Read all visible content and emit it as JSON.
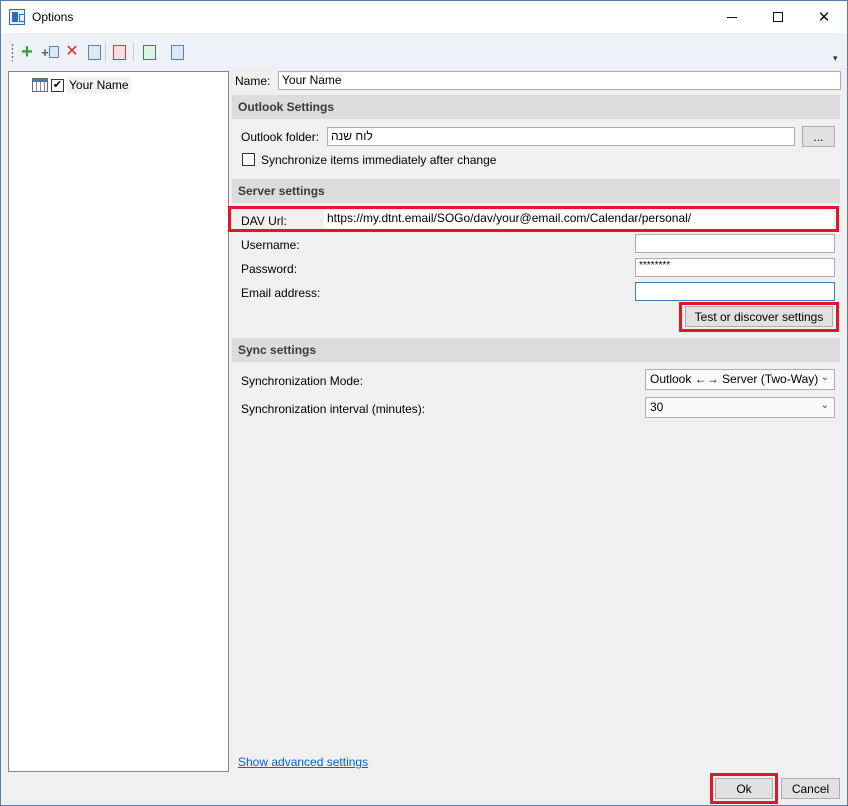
{
  "window": {
    "title": "Options",
    "min_glyph": "—",
    "max_glyph": "☐",
    "close_glyph": "✕"
  },
  "toolbar": {
    "icons": [
      "add-profile-icon",
      "add-multiple-profiles-icon",
      "delete-profile-icon",
      "copy-profile-icon",
      "clear-cache-icon",
      "export-options-icon",
      "import-options-icon"
    ],
    "add_glyph": "+",
    "addmulti_glyph": "+",
    "delete_glyph": "✕",
    "overflow_glyph": "▾"
  },
  "tree": {
    "items": [
      {
        "label": "Your Name",
        "checked": true,
        "check_glyph": "✔"
      }
    ]
  },
  "profile": {
    "name_label": "Name:",
    "name_value": "Your Name"
  },
  "outlook_settings": {
    "header": "Outlook Settings",
    "folder_label": "Outlook folder:",
    "folder_value": "לוח שנה",
    "browse_label": "...",
    "sync_immediately_label": "Synchronize items immediately after change",
    "sync_immediately_checked": false
  },
  "server_settings": {
    "header": "Server settings",
    "dav_url_label": "DAV Url:",
    "dav_url_value": "https://my.dtnt.email/SOGo/dav/your@email.com/Calendar/personal/",
    "username_label": "Username:",
    "username_value": "",
    "password_label": "Password:",
    "password_value": "********",
    "email_label": "Email address:",
    "email_value": "",
    "test_button": "Test or discover settings"
  },
  "sync_settings": {
    "header": "Sync settings",
    "mode_label": "Synchronization Mode:",
    "mode_value": "Outlook ←→ Server (Two-Way)",
    "interval_label": "Synchronization interval (minutes):",
    "interval_value": "30",
    "dropdown_glyph": "⌄"
  },
  "footer": {
    "advanced_link": "Show advanced settings",
    "ok_label": "Ok",
    "cancel_label": "Cancel"
  },
  "colors": {
    "highlight": "#e0162a",
    "link": "#0066cc",
    "section_bg": "#dcdcdc"
  }
}
